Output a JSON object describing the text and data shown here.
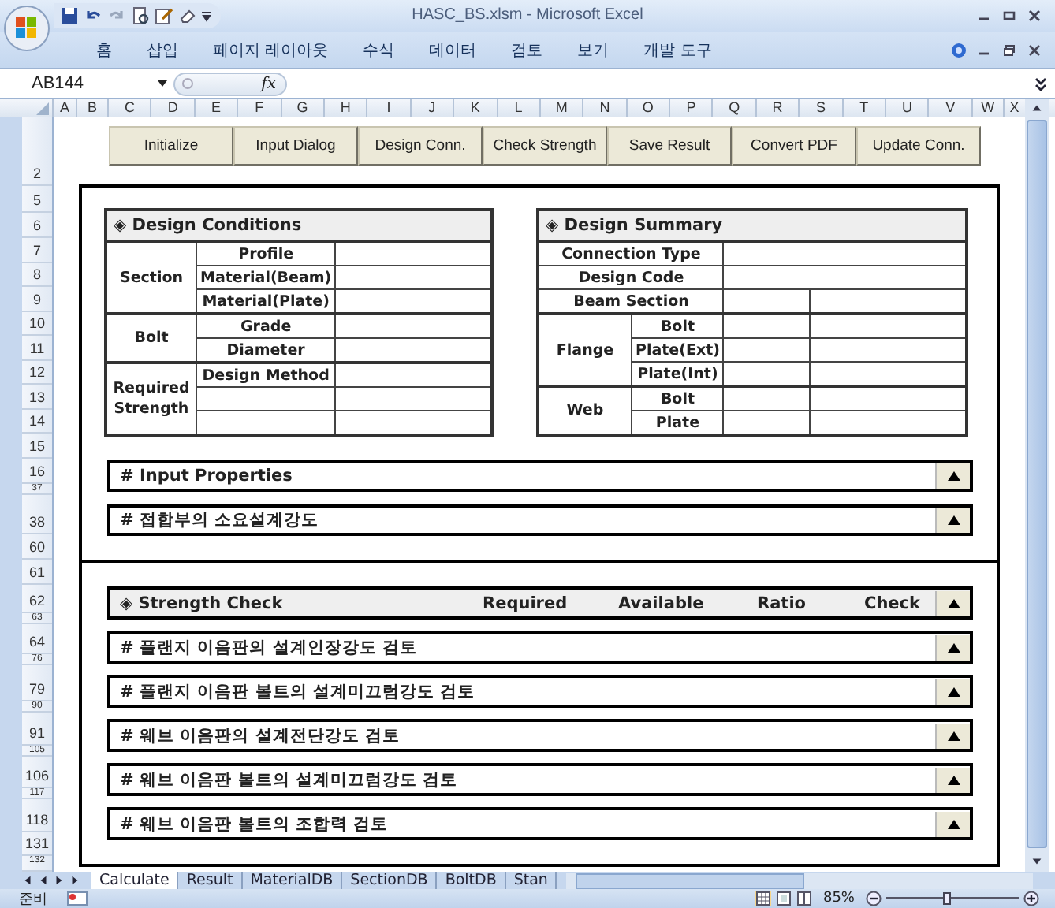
{
  "window": {
    "title": "HASC_BS.xlsm - Microsoft Excel"
  },
  "ribbon_tabs": [
    "홈",
    "삽입",
    "페이지 레이아웃",
    "수식",
    "데이터",
    "검토",
    "보기",
    "개발 도구"
  ],
  "formula_bar": {
    "name_box": "AB144",
    "function_label": "fx"
  },
  "column_headers": [
    "A",
    "B",
    "C",
    "D",
    "E",
    "F",
    "G",
    "H",
    "I",
    "J",
    "K",
    "L",
    "M",
    "N",
    "O",
    "P",
    "Q",
    "R",
    "S",
    "T",
    "U",
    "V",
    "W",
    "X"
  ],
  "row_headers": [
    "2",
    "5",
    "6",
    "7",
    "8",
    "9",
    "10",
    "11",
    "12",
    "13",
    "14",
    "15",
    "16",
    "37",
    "38",
    "60",
    "61",
    "62",
    "63",
    "64",
    "76",
    "79",
    "90",
    "91",
    "105",
    "106",
    "117",
    "118",
    "131",
    "132"
  ],
  "buttons": [
    "Initialize",
    "Input Dialog",
    "Design Conn.",
    "Check Strength",
    "Save Result",
    "Convert PDF",
    "Update Conn."
  ],
  "design_conditions": {
    "title": "◈ Design Conditions",
    "groups": [
      {
        "label": "Section",
        "items": [
          {
            "kind": "label",
            "label": "Profile"
          },
          {
            "kind": "label",
            "label": "Material(Beam)"
          },
          {
            "kind": "label",
            "label": "Material(Plate)"
          }
        ]
      },
      {
        "label": "Bolt",
        "items": [
          {
            "kind": "label",
            "label": "Grade"
          },
          {
            "kind": "label",
            "label": "Diameter"
          }
        ]
      },
      {
        "label": "Required Strength",
        "items": [
          {
            "kind": "label",
            "label": "Design Method"
          },
          {
            "kind": "blank"
          },
          {
            "kind": "blank"
          }
        ]
      }
    ]
  },
  "design_summary": {
    "title": "◈ Design Summary",
    "rows": [
      {
        "kind": "wide",
        "label": "Connection Type"
      },
      {
        "kind": "wide",
        "label": "Design Code"
      },
      {
        "kind": "split",
        "label": "Beam Section"
      }
    ],
    "groups": [
      {
        "label": "Flange",
        "items": [
          "Bolt",
          "Plate(Ext)",
          "Plate(Int)"
        ]
      },
      {
        "label": "Web",
        "items": [
          "Bolt",
          "Plate"
        ]
      }
    ]
  },
  "input_sections": [
    "# Input Properties",
    "# 접합부의 소요설계강도"
  ],
  "strength_check": {
    "title": "◈ Strength Check",
    "columns": [
      "Required",
      "Available",
      "Ratio",
      "Check"
    ]
  },
  "check_sections": [
    "# 플랜지 이음판의 설계인장강도 검토",
    "# 플랜지 이음판 볼트의 설계미끄럼강도 검토",
    "# 웨브 이음판의 설계전단강도 검토",
    "# 웨브 이음판 볼트의 설계미끄럼강도 검토",
    "# 웨브 이음판 볼트의 조합력 검토"
  ],
  "sheet_tabs": [
    {
      "label": "Calculate",
      "selected": true
    },
    {
      "label": "Result",
      "selected": false
    },
    {
      "label": "MaterialDB",
      "selected": false
    },
    {
      "label": "SectionDB",
      "selected": false
    },
    {
      "label": "BoltDB",
      "selected": false
    },
    {
      "label": "Stan",
      "selected": false
    }
  ],
  "status_bar": {
    "status": "준비",
    "zoom": "85%",
    "zoom_slider": {
      "level": 0.45
    }
  }
}
